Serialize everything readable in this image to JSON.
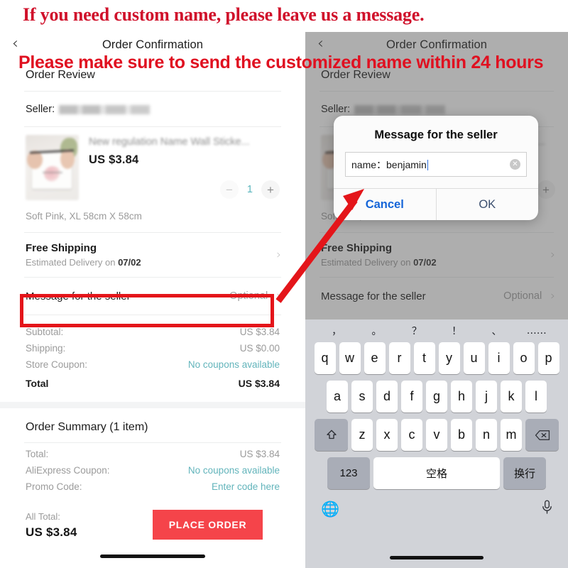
{
  "annotations": {
    "headline": "If you need custom name, please leave us a message.",
    "subline": "Please make sure to send the customized name within 24 hours",
    "highlight_color": "#e4151a",
    "headline_color": "#d0112b"
  },
  "navbar": {
    "back_icon": "chevron-left-icon",
    "title": "Order Confirmation"
  },
  "order_review": {
    "section_title": "Order Review",
    "seller_label": "Seller:",
    "seller_value_redacted": true,
    "product": {
      "name": "New regulation Name Wall Sticke...",
      "price": "US $3.84",
      "sku": "Soft Pink, XL 58cm X 58cm",
      "qty": "1",
      "minus_icon": "minus-icon",
      "plus_icon": "plus-icon",
      "qty_color": "#5bb6bd"
    },
    "shipping": {
      "title": "Free Shipping",
      "subtitle_prefix": "Estimated Delivery on ",
      "date": "07/02",
      "chevron": "chevron-right-icon"
    },
    "message_row": {
      "label": "Message for the seller",
      "value": "Optional",
      "chevron": "chevron-right-icon"
    },
    "totals": [
      {
        "key": "Subtotal:",
        "value": "US $3.84",
        "link": false
      },
      {
        "key": "Shipping:",
        "value": "US $0.00",
        "link": false
      },
      {
        "key": "Store Coupon:",
        "value": "No coupons available",
        "link": true
      },
      {
        "key": "Total",
        "value": "US $3.84",
        "bold": true
      }
    ]
  },
  "order_summary": {
    "title": "Order Summary (1 item)",
    "lines": [
      {
        "key": "Total:",
        "value": "US $3.84",
        "link": false
      },
      {
        "key": "AliExpress Coupon:",
        "value": "No coupons available",
        "link": true
      },
      {
        "key": "Promo Code:",
        "value": "Enter code here",
        "link": true
      }
    ]
  },
  "footer": {
    "all_total_label": "All Total:",
    "all_total_value": "US $3.84",
    "place_order_label": "PLACE ORDER",
    "place_order_color": "#f5444a"
  },
  "dialog": {
    "title": "Message for the seller",
    "input_value": "name：benjamin",
    "clear_icon": "clear-circle-icon",
    "cancel_label": "Cancel",
    "ok_label": "OK",
    "cancel_color": "#1565d8",
    "ok_color": "#3a4e6e"
  },
  "keyboard": {
    "punctuation": [
      "，",
      "。",
      "？",
      "！",
      "、",
      "……"
    ],
    "row1": [
      "q",
      "w",
      "e",
      "r",
      "t",
      "y",
      "u",
      "i",
      "o",
      "p"
    ],
    "row2": [
      "a",
      "s",
      "d",
      "f",
      "g",
      "h",
      "j",
      "k",
      "l"
    ],
    "row3": [
      "z",
      "x",
      "c",
      "v",
      "b",
      "n",
      "m"
    ],
    "shift_icon": "shift-icon",
    "backspace_icon": "backspace-icon",
    "numeric_label": "123",
    "space_label": "空格",
    "return_label": "换行",
    "globe_icon": "globe-icon",
    "mic_icon": "microphone-icon"
  }
}
